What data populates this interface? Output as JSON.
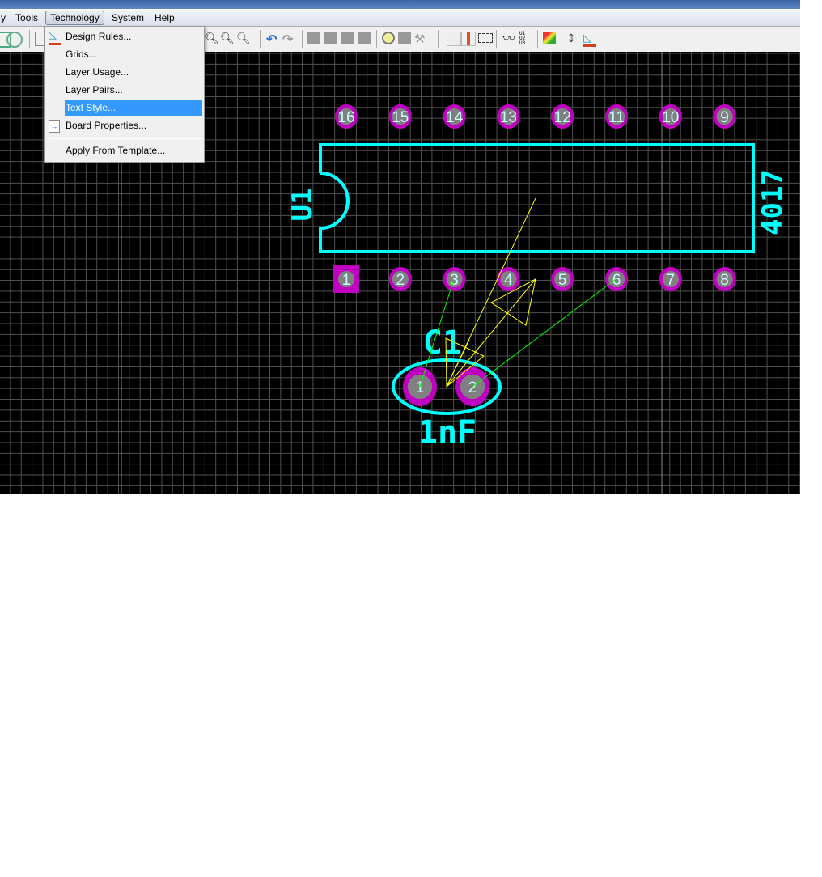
{
  "menubar": {
    "items": [
      {
        "label": "y"
      },
      {
        "label": "Tools"
      },
      {
        "label": "Technology"
      },
      {
        "label": "System"
      },
      {
        "label": "Help"
      }
    ]
  },
  "technology_menu": {
    "items": [
      {
        "label": "Design Rules...",
        "icon": "design-rules-icon"
      },
      {
        "label": "Grids..."
      },
      {
        "label": "Layer Usage..."
      },
      {
        "label": "Layer Pairs..."
      },
      {
        "label": "Text Style...",
        "highlighted": true
      },
      {
        "label": "Board Properties...",
        "icon": "board-properties-icon"
      },
      {
        "label": "Apply From Template..."
      }
    ]
  },
  "toolbar": {
    "u_label": "U1\nU2\nU3"
  },
  "pcb": {
    "ic": {
      "ref": "U1",
      "value": "4017",
      "top_pins": [
        "16",
        "15",
        "14",
        "13",
        "12",
        "11",
        "10",
        "9"
      ],
      "bottom_pins": [
        "1",
        "2",
        "3",
        "4",
        "5",
        "6",
        "7",
        "8"
      ]
    },
    "cap": {
      "ref": "C1",
      "value": "1nF",
      "pins": [
        "1",
        "2"
      ]
    },
    "colors": {
      "silk": "#00ffff",
      "pad": "#c000c0",
      "grid": "#505050",
      "ratsnest": "#00ff00",
      "highlight": "#ffff00"
    }
  }
}
